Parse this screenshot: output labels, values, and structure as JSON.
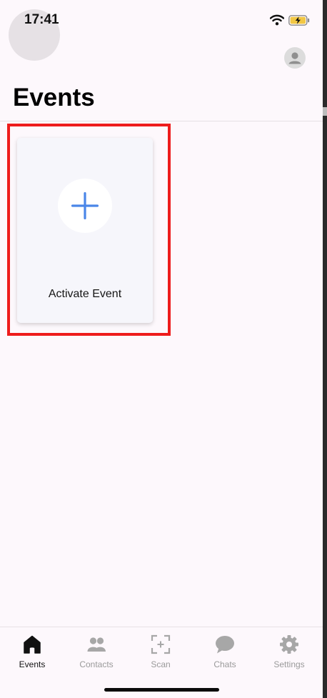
{
  "status_bar": {
    "time": "17:41",
    "icons": [
      "wifi-icon",
      "battery-charging-icon"
    ]
  },
  "header": {
    "title": "Events",
    "profile_icon": "person-icon"
  },
  "main": {
    "cards": [
      {
        "label": "Activate Event",
        "icon": "plus-icon"
      }
    ]
  },
  "tab_bar": {
    "tabs": [
      {
        "label": "Events",
        "icon": "home-icon",
        "active": true
      },
      {
        "label": "Contacts",
        "icon": "people-icon",
        "active": false
      },
      {
        "label": "Scan",
        "icon": "scan-icon",
        "active": false
      },
      {
        "label": "Chats",
        "icon": "chat-bubble-icon",
        "active": false
      },
      {
        "label": "Settings",
        "icon": "gear-icon",
        "active": false
      }
    ]
  },
  "colors": {
    "background": "#fdf8fc",
    "accent_blue": "#4a86e8",
    "highlight_red": "#ee1c1c",
    "active_tab": "#111111",
    "inactive_tab": "#9a9a9a"
  }
}
